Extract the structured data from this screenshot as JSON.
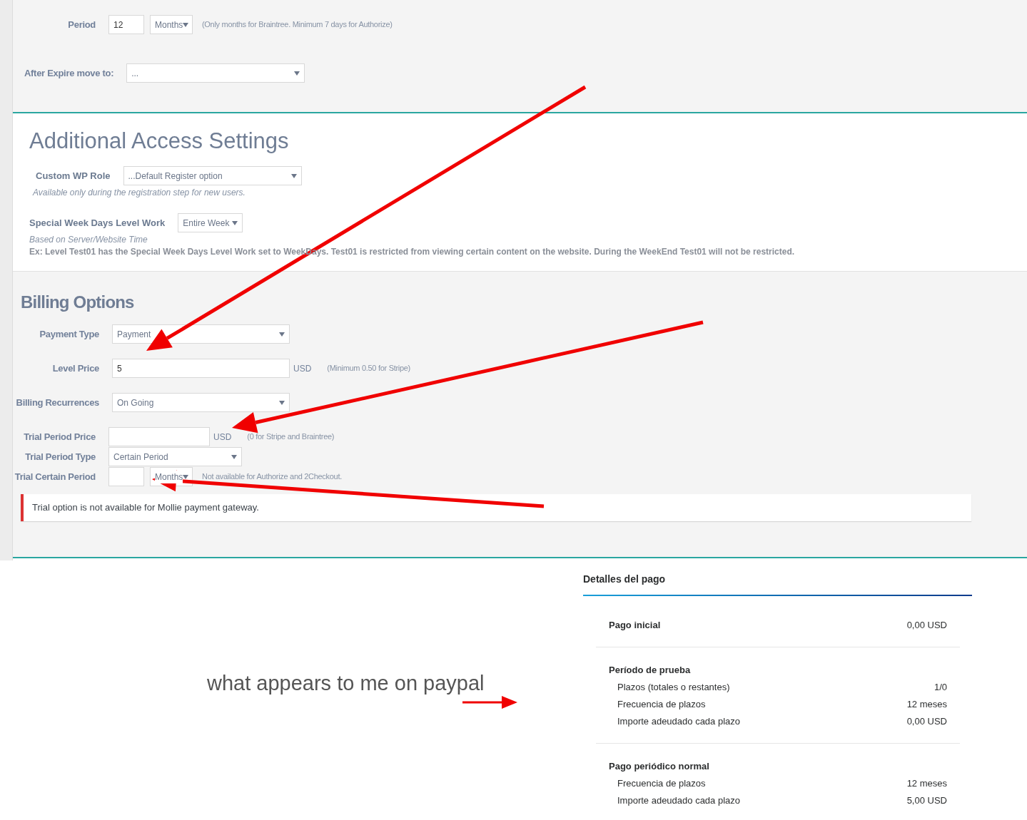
{
  "period_section": {
    "period": {
      "label": "Period",
      "value": "12",
      "unit": "Months",
      "hint": "(Only months for Braintree. Minimum 7 days for Authorize)"
    },
    "after_expire": {
      "label": "After Expire move to:",
      "value": "..."
    }
  },
  "access_section": {
    "title": "Additional Access Settings",
    "custom_role": {
      "label": "Custom WP Role",
      "value": "...Default Register option",
      "hint": "Available only during the registration step for new users."
    },
    "week_days": {
      "label": "Special Week Days Level Work",
      "value": "Entire Week",
      "hint": "Based on Server/Website Time",
      "example": "Ex: Level Test01 has the Special Week Days Level Work set to WeekDays. Test01 is restricted from viewing certain content on the website. During the WeekEnd Test01 will not be restricted."
    }
  },
  "billing_section": {
    "title": "Billing Options",
    "rows": [
      {
        "kind": "select",
        "label": "Payment Type",
        "value": "Payment"
      },
      {
        "kind": "input",
        "label": "Level Price",
        "value": "5",
        "unit": "USD",
        "hint": "(Minimum 0.50 for Stripe)"
      },
      {
        "kind": "select",
        "label": "Billing Recurrences",
        "value": "On Going"
      }
    ],
    "trial_rows": [
      {
        "kind": "input",
        "label": "Trial Period Price",
        "unit": "USD",
        "hint": "(0 for Stripe and Braintree)"
      },
      {
        "kind": "select",
        "label": "Trial Period Type",
        "value": "Certain Period"
      },
      {
        "kind": "input_select",
        "label": "Trial Certain Period",
        "select_value": "Months",
        "hint": "Not available for Authorize and 2Checkout."
      }
    ],
    "notice": "Trial option is not available for Mollie payment gateway."
  },
  "caption": "what appears to me on paypal",
  "paypal": {
    "title": "Detalles del pago",
    "groups": [
      {
        "title": "Pago inicial",
        "value": "0,00 USD"
      },
      {
        "title": "Período de prueba",
        "rows": [
          {
            "label": "Plazos (totales o restantes)",
            "value": "1/0"
          },
          {
            "label": "Frecuencia de plazos",
            "value": "12 meses"
          },
          {
            "label": "Importe adeudado cada plazo",
            "value": "0,00 USD"
          }
        ]
      },
      {
        "title": "Pago periódico normal",
        "rows": [
          {
            "label": "Frecuencia de plazos",
            "value": "12 meses"
          },
          {
            "label": "Importe adeudado cada plazo",
            "value": "5,00 USD"
          }
        ]
      }
    ]
  }
}
